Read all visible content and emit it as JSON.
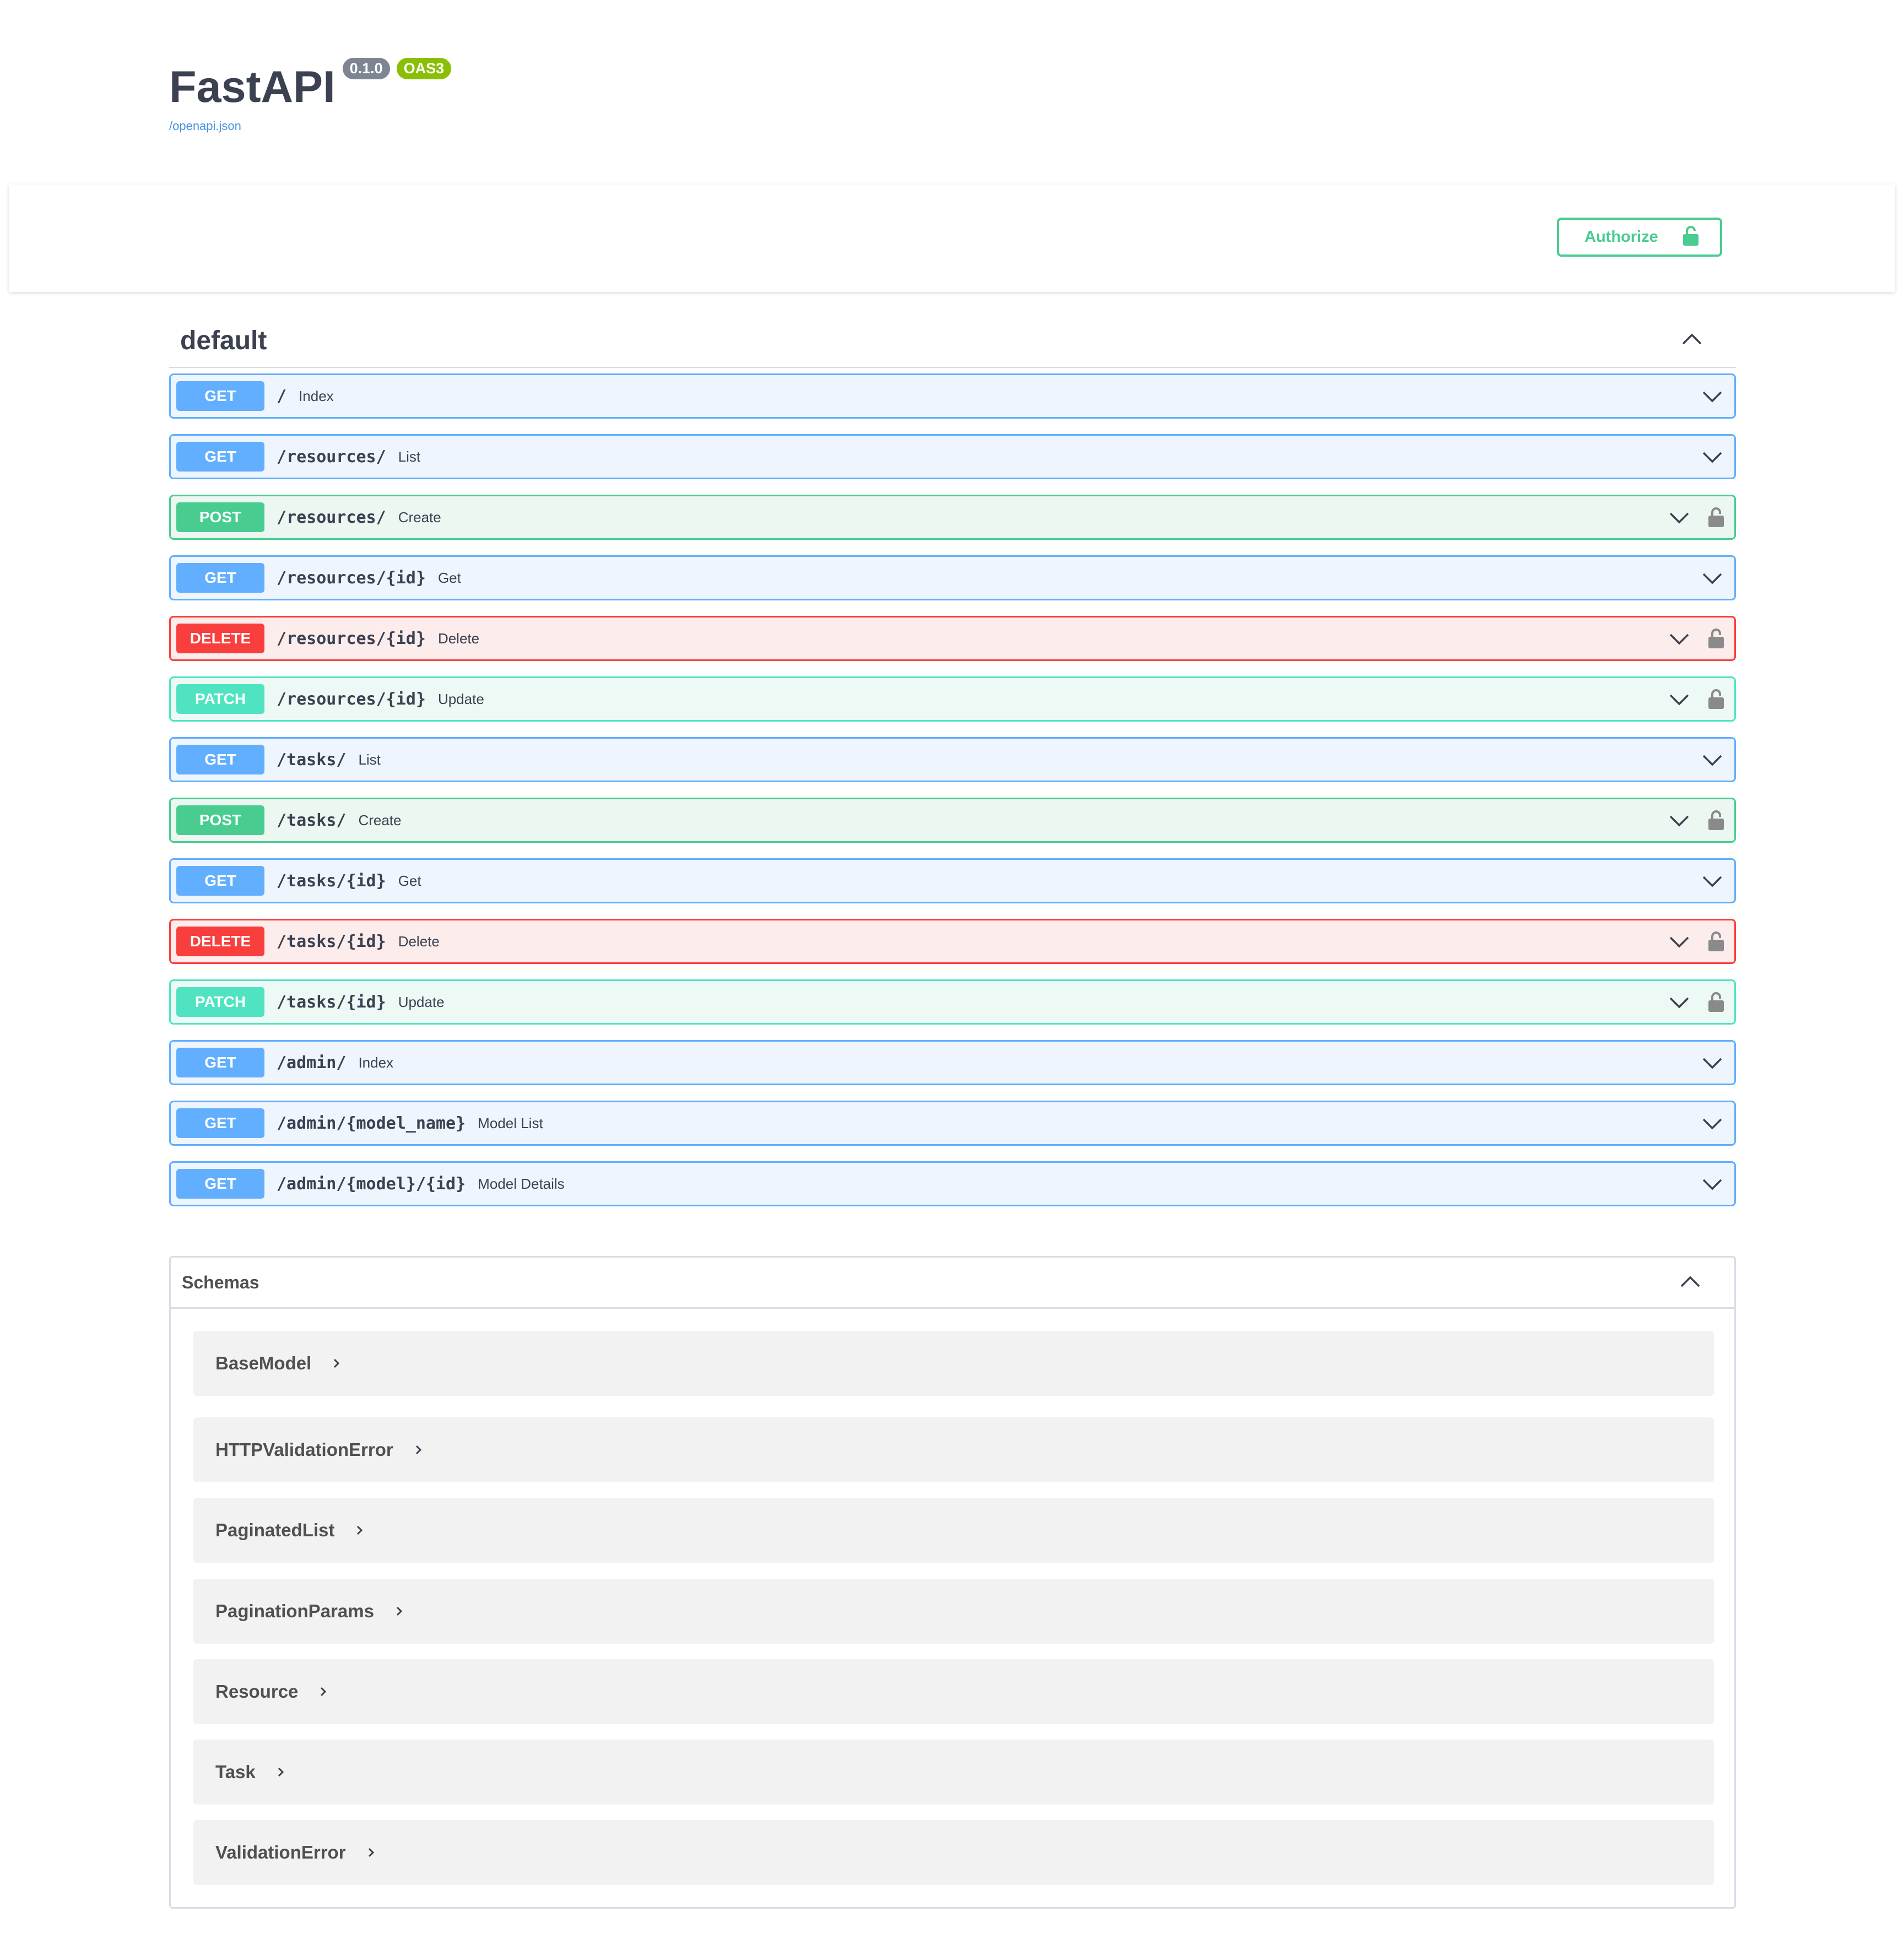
{
  "info": {
    "title": "FastAPI",
    "version": "0.1.0",
    "oas": "OAS3",
    "spec_link": "/openapi.json"
  },
  "authorize": {
    "label": "Authorize"
  },
  "tag": {
    "name": "default"
  },
  "operations": [
    {
      "method": "GET",
      "path": "/",
      "summary": "Index",
      "locked": false
    },
    {
      "method": "GET",
      "path": "/resources/",
      "summary": "List",
      "locked": false
    },
    {
      "method": "POST",
      "path": "/resources/",
      "summary": "Create",
      "locked": true
    },
    {
      "method": "GET",
      "path": "/resources/{id}",
      "summary": "Get",
      "locked": false
    },
    {
      "method": "DELETE",
      "path": "/resources/{id}",
      "summary": "Delete",
      "locked": true
    },
    {
      "method": "PATCH",
      "path": "/resources/{id}",
      "summary": "Update",
      "locked": true
    },
    {
      "method": "GET",
      "path": "/tasks/",
      "summary": "List",
      "locked": false
    },
    {
      "method": "POST",
      "path": "/tasks/",
      "summary": "Create",
      "locked": true
    },
    {
      "method": "GET",
      "path": "/tasks/{id}",
      "summary": "Get",
      "locked": false
    },
    {
      "method": "DELETE",
      "path": "/tasks/{id}",
      "summary": "Delete",
      "locked": true
    },
    {
      "method": "PATCH",
      "path": "/tasks/{id}",
      "summary": "Update",
      "locked": true
    },
    {
      "method": "GET",
      "path": "/admin/",
      "summary": "Index",
      "locked": false
    },
    {
      "method": "GET",
      "path": "/admin/{model_name}",
      "summary": "Model List",
      "locked": false
    },
    {
      "method": "GET",
      "path": "/admin/{model}/{id}",
      "summary": "Model Details",
      "locked": false
    }
  ],
  "schemas": {
    "title": "Schemas",
    "items": [
      "BaseModel",
      "HTTPValidationError",
      "PaginatedList",
      "PaginationParams",
      "Resource",
      "Task",
      "ValidationError"
    ]
  },
  "colors": {
    "get": "#61affe",
    "post": "#49cc90",
    "delete": "#f93e3e",
    "patch": "#50e3c2",
    "authorize": "#49cc90"
  }
}
